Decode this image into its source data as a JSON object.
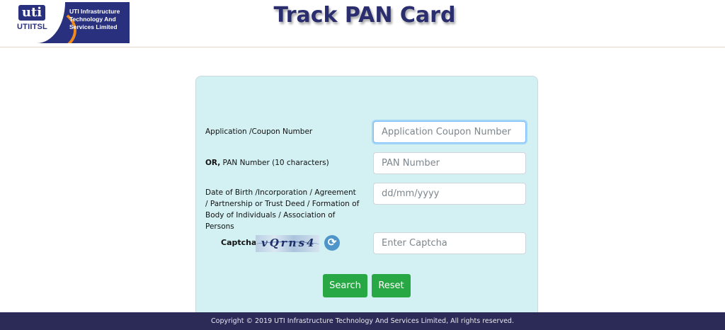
{
  "logo": {
    "badge": "uti",
    "short": "UTIITSL",
    "line1": "UTI Infrastructure",
    "line2": "Technology And",
    "line3": "Services Limited"
  },
  "page_title": "Track PAN Card",
  "form": {
    "application_label": "Application /Coupon Number",
    "application_placeholder": "Application Coupon Number",
    "pan_label_or": "OR,",
    "pan_label_rest": " PAN Number (10 characters)",
    "pan_placeholder": "PAN Number",
    "dob_label": "Date of Birth /Incorporation / Agreement / Partnership or Trust Deed / Formation of Body of Individuals / Association of Persons",
    "dob_placeholder": "dd/mm/yyyy",
    "captcha_label": "Captcha",
    "captcha_text": "vQrns4",
    "captcha_placeholder": "Enter Captcha",
    "search_label": "Search",
    "reset_label": "Reset"
  },
  "footer": {
    "copyright": "Copyright © 2019 UTI Infrastructure Technology And Services Limited, All rights reserved."
  },
  "colors": {
    "header_title": "#2a2e6f",
    "panel_bg": "#d3f0f3",
    "button": "#28a745",
    "footer_bg": "#2c2a56",
    "logo_blue": "#29307e",
    "logo_orange": "#f08a1c"
  },
  "icons": {
    "refresh": "refresh-icon"
  }
}
